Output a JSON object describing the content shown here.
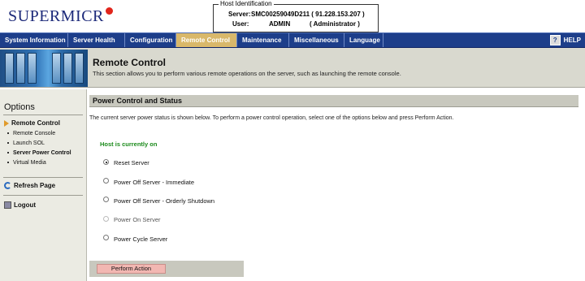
{
  "brand": {
    "name": "SUPERMICR",
    "accent": "#e1251b",
    "primary": "#1d2a7a"
  },
  "host": {
    "legend": "Host Identification",
    "server_label": "Server:",
    "server_value": "SMC00259049D211  ( 91.228.153.207 )",
    "user_label": "User:",
    "user_value": "ADMIN",
    "user_role": "( Administrator )"
  },
  "nav": {
    "items": [
      {
        "label": "System Information"
      },
      {
        "label": "Server Health"
      },
      {
        "label": "Configuration"
      },
      {
        "label": "Remote Control"
      },
      {
        "label": "Maintenance"
      },
      {
        "label": "Miscellaneous"
      },
      {
        "label": "Language"
      }
    ],
    "active_index": 3,
    "help_label": "HELP",
    "help_icon": "question-icon"
  },
  "banner": {
    "title": "Remote Control",
    "description": "This section allows you to perform various remote operations on the server, such as launching the remote console."
  },
  "sidebar": {
    "title": "Options",
    "section": "Remote Control",
    "items": [
      "Remote Console",
      "Launch SOL",
      "Server Power Control",
      "Virtual Media"
    ],
    "selected_index": 2,
    "refresh_label": "Refresh Page",
    "logout_label": "Logout"
  },
  "main": {
    "header": "Power Control and Status",
    "description": "The current server power status is shown below. To perform a power control operation, select one of the options below and press Perform Action.",
    "status": "Host is currently on",
    "status_color": "#1a8a1a",
    "options": [
      {
        "label": "Reset Server",
        "checked": true,
        "disabled": false
      },
      {
        "label": "Power Off Server - Immediate",
        "checked": false,
        "disabled": false
      },
      {
        "label": "Power Off Server - Orderly Shutdown",
        "checked": false,
        "disabled": false
      },
      {
        "label": "Power On Server",
        "checked": false,
        "disabled": true
      },
      {
        "label": "Power Cycle Server",
        "checked": false,
        "disabled": false
      }
    ],
    "action_label": "Perform Action"
  }
}
